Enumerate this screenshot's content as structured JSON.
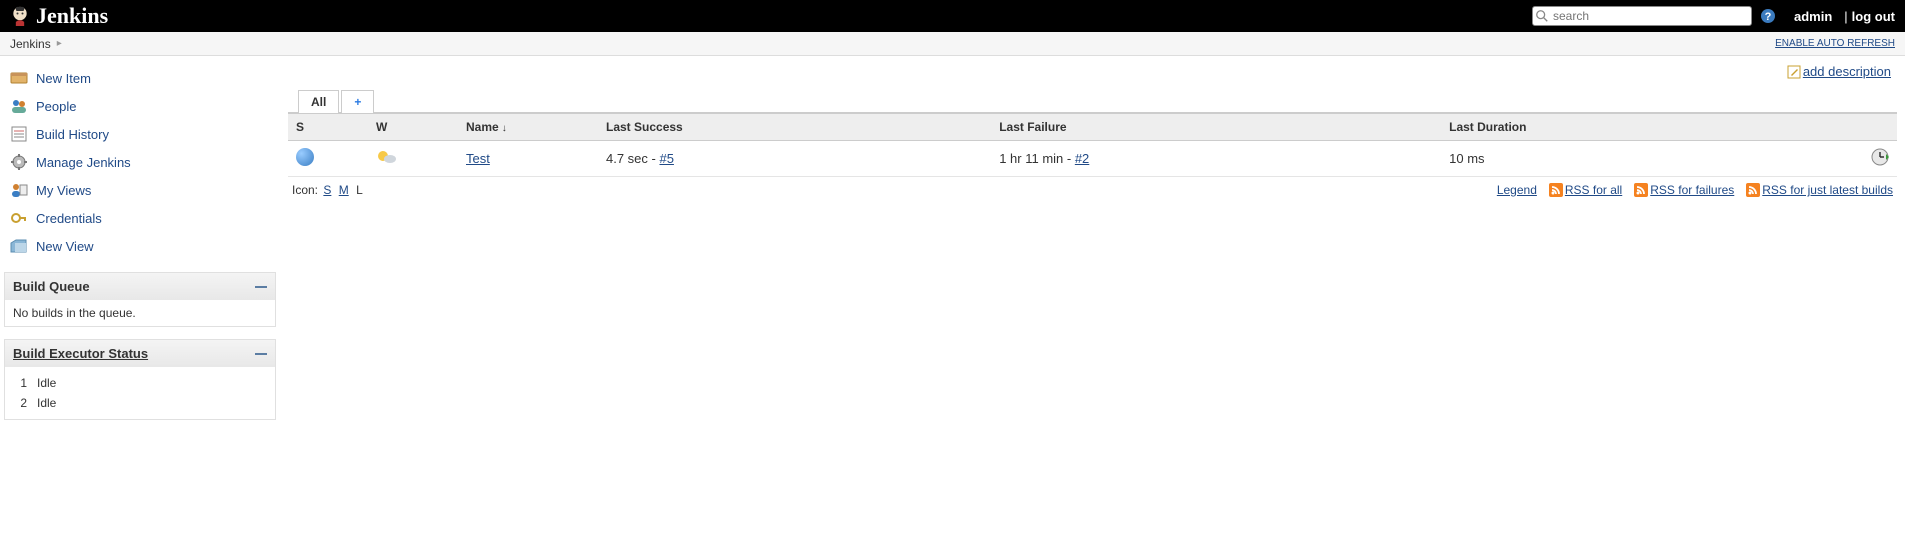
{
  "header": {
    "brand": "Jenkins",
    "search_placeholder": "search",
    "user": "admin",
    "logout": "log out"
  },
  "breadcrumb": {
    "items": [
      "Jenkins"
    ],
    "auto_refresh": "ENABLE AUTO REFRESH"
  },
  "sidebar": {
    "nav": [
      {
        "label": "New Item",
        "icon": "new-item"
      },
      {
        "label": "People",
        "icon": "people"
      },
      {
        "label": "Build History",
        "icon": "build-history"
      },
      {
        "label": "Manage Jenkins",
        "icon": "manage"
      },
      {
        "label": "My Views",
        "icon": "my-views"
      },
      {
        "label": "Credentials",
        "icon": "credentials"
      },
      {
        "label": "New View",
        "icon": "new-view"
      }
    ],
    "build_queue": {
      "title": "Build Queue",
      "empty": "No builds in the queue."
    },
    "executor": {
      "title": "Build Executor Status",
      "rows": [
        {
          "num": "1",
          "state": "Idle"
        },
        {
          "num": "2",
          "state": "Idle"
        }
      ]
    }
  },
  "main": {
    "add_description": "add description",
    "tabs": {
      "all": "All",
      "plus": "+"
    },
    "columns": {
      "s": "S",
      "w": "W",
      "name": "Name",
      "last_success": "Last Success",
      "last_failure": "Last Failure",
      "last_duration": "Last Duration"
    },
    "sort_indicator": "↓",
    "rows": [
      {
        "name": "Test",
        "last_success_prefix": "4.7 sec - ",
        "last_success_link": "#5",
        "last_failure_prefix": "1 hr 11 min - ",
        "last_failure_link": "#2",
        "last_duration": "10 ms"
      }
    ],
    "icon_label": "Icon:",
    "icon_sizes": {
      "s": "S",
      "m": "M",
      "l": "L"
    },
    "footer_links": {
      "legend": "Legend",
      "rss_all": "RSS for all",
      "rss_failures": "RSS for failures",
      "rss_latest": "RSS for just latest builds"
    }
  }
}
